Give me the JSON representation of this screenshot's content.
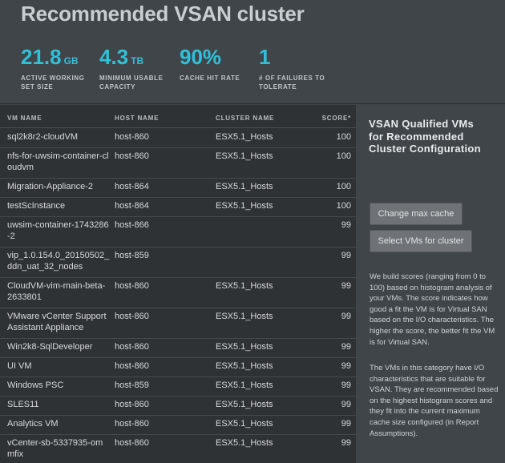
{
  "header": {
    "title": "Recommended VSAN cluster",
    "stats": [
      {
        "value": "21.8",
        "unit": "GB",
        "label": "Active working set size"
      },
      {
        "value": "4.3",
        "unit": "TB",
        "label": "Minimum usable capacity"
      },
      {
        "value": "90%",
        "unit": "",
        "label": "Cache hit rate"
      },
      {
        "value": "1",
        "unit": "",
        "label": "# of failures to tolerate"
      }
    ]
  },
  "table": {
    "columns": {
      "vm": "VM NAME",
      "host": "HOST NAME",
      "cluster": "CLUSTER NAME",
      "score": "SCORE*"
    },
    "rows": [
      {
        "vm": "sql2k8r2-cloudVM",
        "host": "host-860",
        "cluster": "ESX5.1_Hosts",
        "score": "100"
      },
      {
        "vm": "nfs-for-uwsim-container-cloudvm",
        "host": "host-860",
        "cluster": "ESX5.1_Hosts",
        "score": "100"
      },
      {
        "vm": "Migration-Appliance-2",
        "host": "host-864",
        "cluster": "ESX5.1_Hosts",
        "score": "100"
      },
      {
        "vm": "testScInstance",
        "host": "host-864",
        "cluster": "ESX5.1_Hosts",
        "score": "100"
      },
      {
        "vm": "uwsim-container-1743286-2",
        "host": "host-866",
        "cluster": "",
        "score": "99"
      },
      {
        "vm": "vip_1.0.154.0_20150502_ddn_uat_32_nodes",
        "host": "host-859",
        "cluster": "",
        "score": "99"
      },
      {
        "vm": "CloudVM-vim-main-beta-2633801",
        "host": "host-860",
        "cluster": "ESX5.1_Hosts",
        "score": "99"
      },
      {
        "vm": "VMware vCenter Support Assistant Appliance",
        "host": "host-860",
        "cluster": "ESX5.1_Hosts",
        "score": "99"
      },
      {
        "vm": "Win2k8-SqlDeveloper",
        "host": "host-860",
        "cluster": "ESX5.1_Hosts",
        "score": "99"
      },
      {
        "vm": "UI VM",
        "host": "host-860",
        "cluster": "ESX5.1_Hosts",
        "score": "99"
      },
      {
        "vm": "Windows PSC",
        "host": "host-859",
        "cluster": "ESX5.1_Hosts",
        "score": "99"
      },
      {
        "vm": "SLES11",
        "host": "host-860",
        "cluster": "ESX5.1_Hosts",
        "score": "99"
      },
      {
        "vm": "Analytics VM",
        "host": "host-860",
        "cluster": "ESX5.1_Hosts",
        "score": "99"
      },
      {
        "vm": "vCenter-sb-5337935-ommfix",
        "host": "host-860",
        "cluster": "ESX5.1_Hosts",
        "score": "99"
      }
    ]
  },
  "sidebar": {
    "title": "VSAN Qualified VMs for Recommended Cluster Configuration",
    "change_cache_label": "Change max cache",
    "select_vms_label": "Select VMs for cluster",
    "paragraph1": "We build scores (ranging from 0 to 100) based on histogram analysis of your VMs. The score indicates how good a fit the VM is for Virtual SAN based on the I/O characteristics. The higher the score, the better fit the VM is for Virtual SAN.",
    "paragraph2": "The VMs in this category have I/O characteristics that are suitable for VSAN. They are recommended based on the highest histogram scores and they fit into the current maximum cache size configured (in Report Assumptions)."
  }
}
